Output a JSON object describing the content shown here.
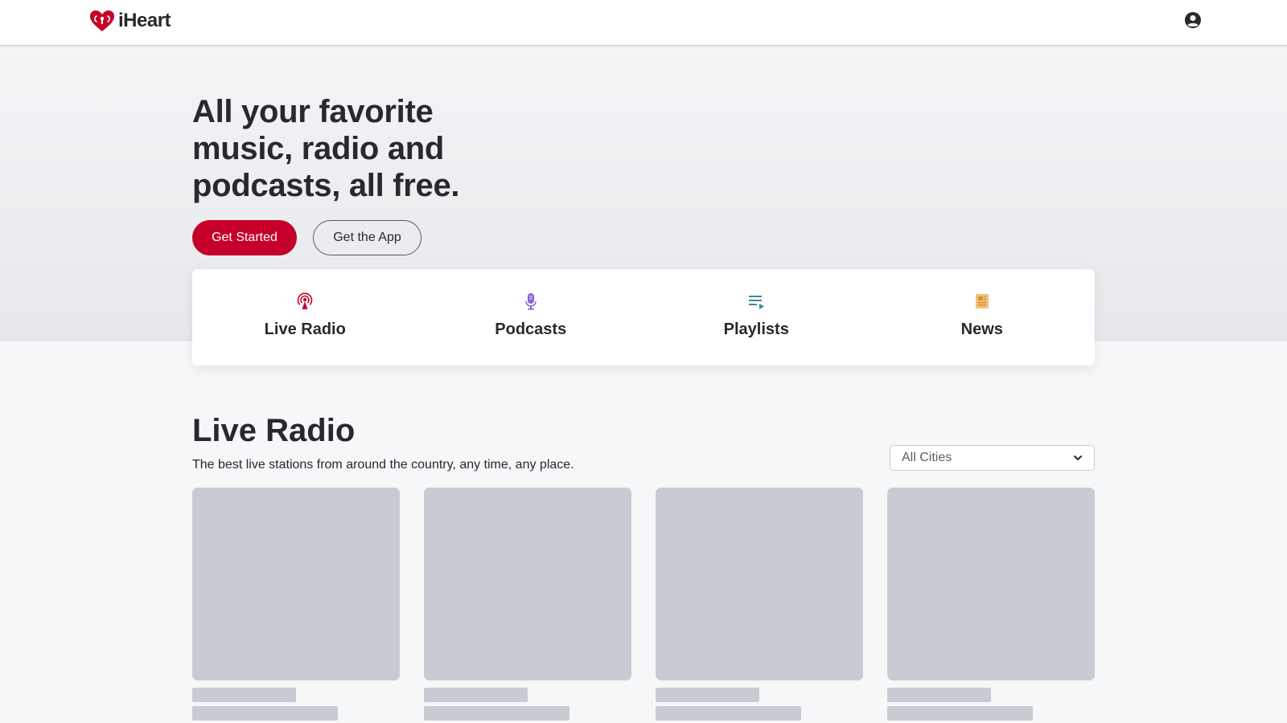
{
  "header": {
    "logo_text": "iHeart",
    "user_icon": "user-circle-icon"
  },
  "hero": {
    "title": "All your favorite music, radio and podcasts, all free.",
    "get_started_label": "Get Started",
    "get_app_label": "Get the App"
  },
  "categories": [
    {
      "label": "Live Radio",
      "icon": "radio-tower-icon",
      "color": "#c6002b"
    },
    {
      "label": "Podcasts",
      "icon": "microphone-icon",
      "color": "#8a63d2"
    },
    {
      "label": "Playlists",
      "icon": "playlist-icon",
      "color": "#3d8b8d"
    },
    {
      "label": "News",
      "icon": "newspaper-icon",
      "color": "#e8a74a"
    }
  ],
  "live_radio": {
    "title": "Live Radio",
    "subtitle": "The best live stations from around the country, any time, any place.",
    "city_select_value": "All Cities"
  },
  "colors": {
    "brand_red": "#c6002b",
    "text_dark": "#27292d",
    "skeleton": "#c6ccd2"
  }
}
